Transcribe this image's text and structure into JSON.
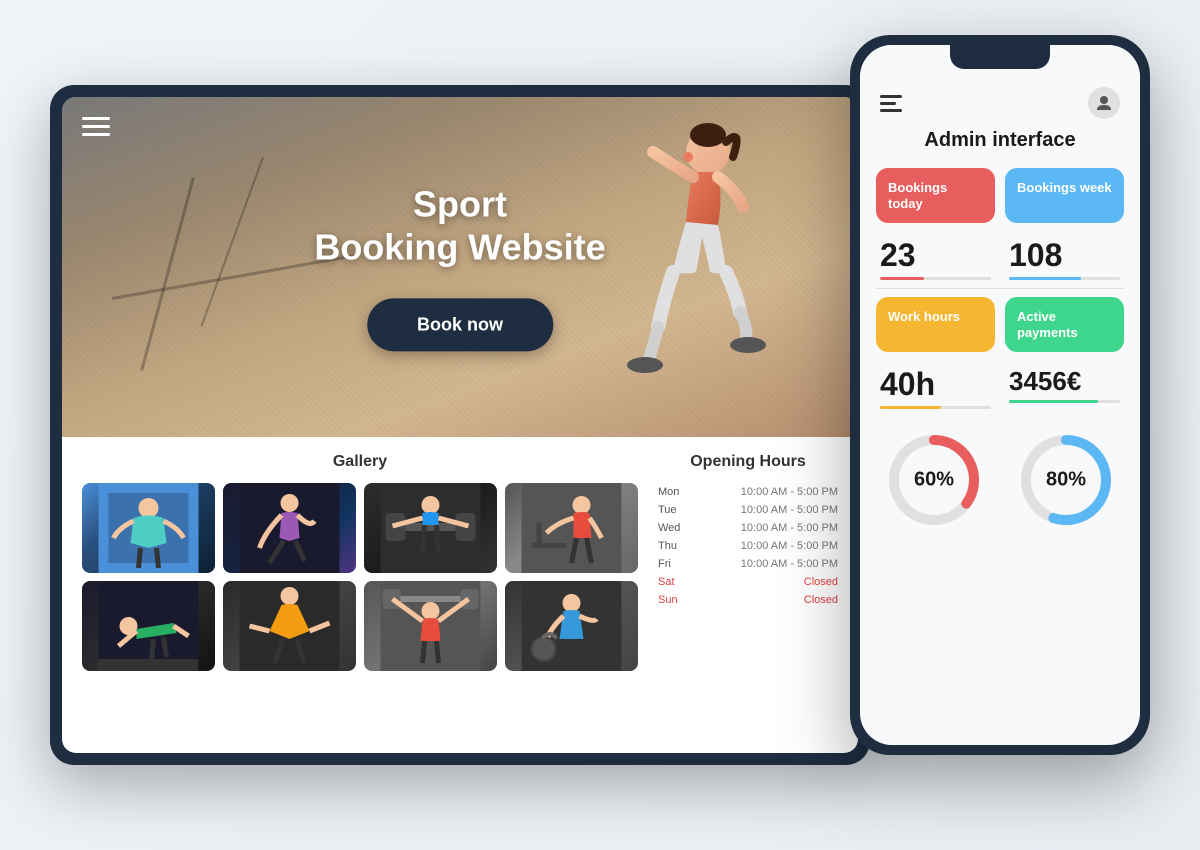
{
  "tablet": {
    "hero": {
      "title_line1": "Sport",
      "title_line2": "Booking Website",
      "book_button": "Book now"
    },
    "gallery": {
      "title": "Gallery",
      "items": [
        {
          "id": 1,
          "class": "gym-photo-1"
        },
        {
          "id": 2,
          "class": "gym-photo-2"
        },
        {
          "id": 3,
          "class": "gym-photo-3"
        },
        {
          "id": 4,
          "class": "gym-photo-4"
        },
        {
          "id": 5,
          "class": "gym-photo-5"
        },
        {
          "id": 6,
          "class": "gym-photo-6"
        },
        {
          "id": 7,
          "class": "gym-photo-7"
        },
        {
          "id": 8,
          "class": "gym-photo-8"
        }
      ]
    },
    "opening_hours": {
      "title": "Opening Hours",
      "rows": [
        {
          "day": "Mon",
          "time": "10:00 AM - 5:00 PM",
          "closed": false
        },
        {
          "day": "Tue",
          "time": "10:00 AM - 5:00 PM",
          "closed": false
        },
        {
          "day": "Wed",
          "time": "10:00 AM - 5:00 PM",
          "closed": false
        },
        {
          "day": "Thu",
          "time": "10:00 AM - 5:00 PM",
          "closed": false
        },
        {
          "day": "Fri",
          "time": "10:00 AM - 5:00 PM",
          "closed": false
        },
        {
          "day": "Sat",
          "time": "Closed",
          "closed": true
        },
        {
          "day": "Sun",
          "time": "Closed",
          "closed": true
        }
      ]
    }
  },
  "phone": {
    "menu_icon": "menu",
    "user_icon": "user",
    "admin_title": "Admin interface",
    "stats": [
      {
        "label": "Bookings today",
        "color": "red",
        "value": "23",
        "bar_width": "40"
      },
      {
        "label": "Bookings week",
        "color": "blue",
        "value": "108",
        "bar_width": "65"
      },
      {
        "label": "Work hours",
        "color": "yellow",
        "value": "40h",
        "bar_width": "55"
      },
      {
        "label": "Active payments",
        "color": "green",
        "value": "3456€",
        "bar_width": "80"
      }
    ],
    "charts": [
      {
        "percent": "60%",
        "color": "#e85d5d",
        "value": 60
      },
      {
        "percent": "80%",
        "color": "#5bb8f5",
        "value": 80
      }
    ]
  }
}
